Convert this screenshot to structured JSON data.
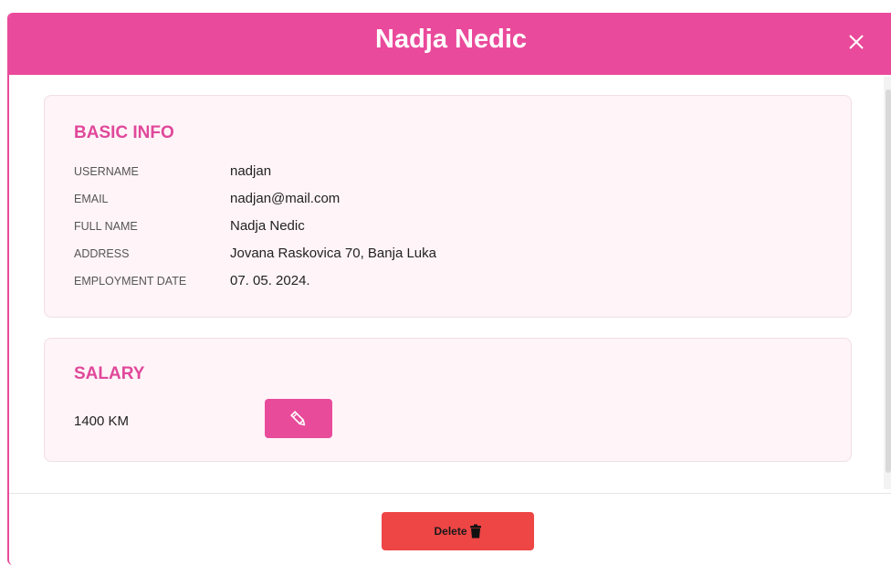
{
  "modal": {
    "title": "Nadja Nedic"
  },
  "basic_info": {
    "title": "BASIC INFO",
    "rows": [
      {
        "label": "USERNAME",
        "value": "nadjan"
      },
      {
        "label": "EMAIL",
        "value": "nadjan@mail.com"
      },
      {
        "label": "FULL NAME",
        "value": "Nadja Nedic"
      },
      {
        "label": "ADDRESS",
        "value": "Jovana Raskovica 70, Banja Luka"
      },
      {
        "label": "EMPLOYMENT DATE",
        "value": "07. 05. 2024."
      }
    ]
  },
  "salary": {
    "title": "SALARY",
    "value": "1400 KM",
    "edit_icon": "pencil-icon"
  },
  "footer": {
    "delete_label": "Delete",
    "delete_icon": "trash-icon"
  },
  "colors": {
    "accent": "#ea4a9b",
    "card_bg": "#fff4f8",
    "danger": "#ee4545"
  }
}
